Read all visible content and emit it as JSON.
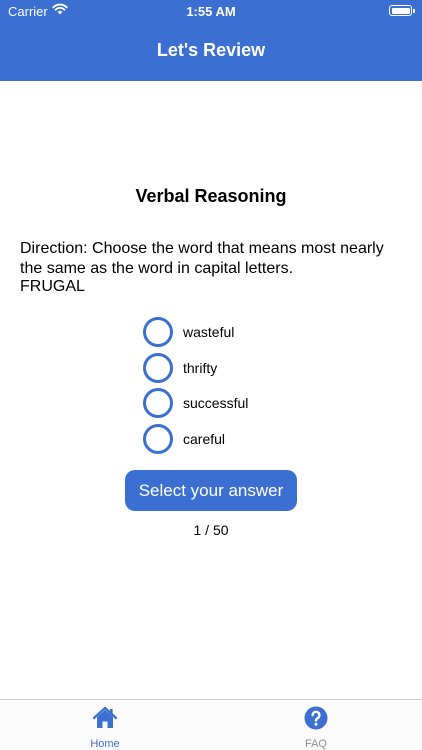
{
  "status_bar": {
    "carrier": "Carrier",
    "time": "1:55 AM"
  },
  "header": {
    "title": "Let's Review"
  },
  "section": {
    "title": "Verbal Reasoning"
  },
  "question": {
    "direction": "Direction: Choose the word that means most nearly the same as the word in capital letters.",
    "word": "FRUGAL",
    "options": [
      "wasteful",
      "thrifty",
      "successful",
      "careful"
    ]
  },
  "answer_button": {
    "label": "Select your answer"
  },
  "progress": {
    "text": "1 / 50"
  },
  "tabs": [
    {
      "label": "Home",
      "icon": "home-icon",
      "active": true
    },
    {
      "label": "FAQ",
      "icon": "question-circle-icon",
      "active": false
    }
  ],
  "colors": {
    "accent": "#3b6fd1",
    "inactive_tab": "#8e8e93"
  }
}
